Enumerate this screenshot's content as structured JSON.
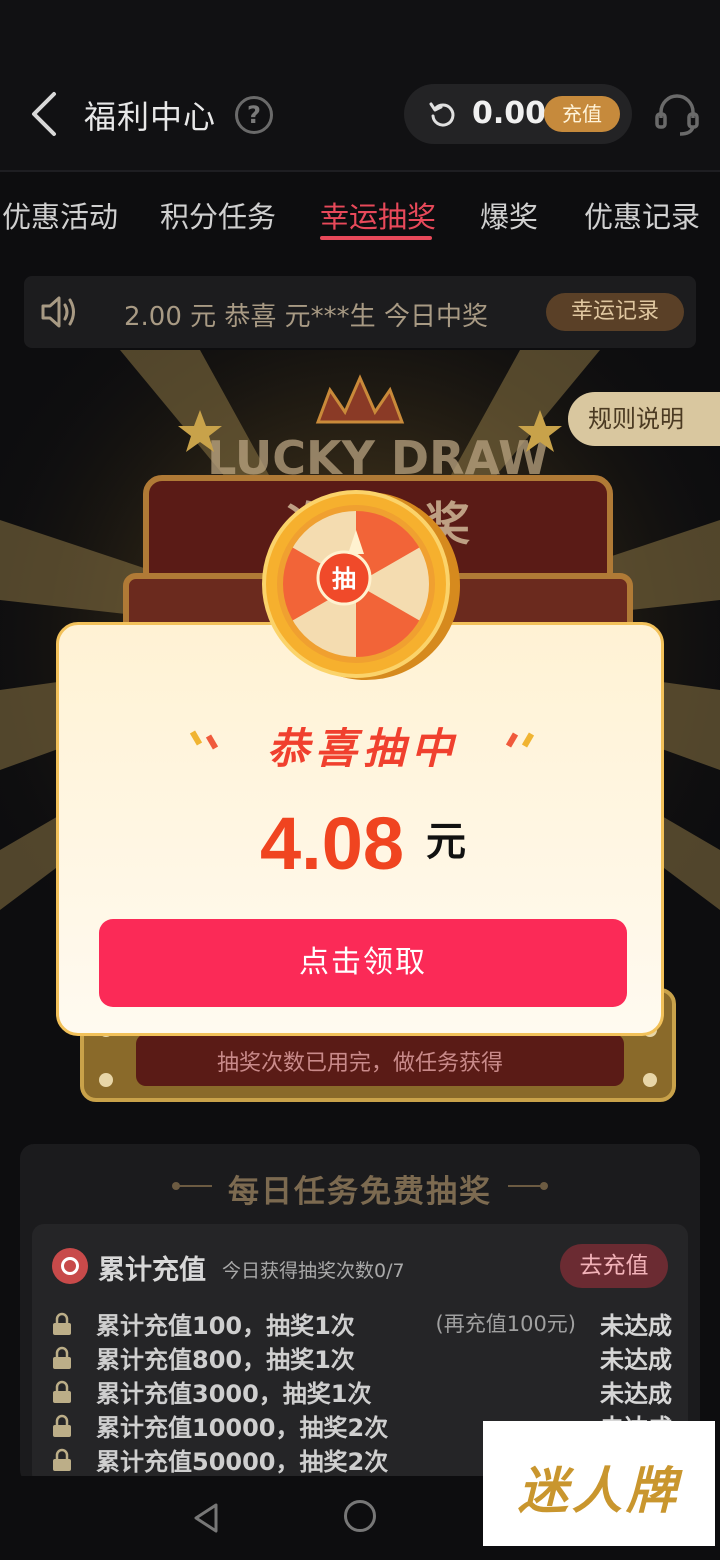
{
  "header": {
    "title": "福利中心",
    "balance": "0.00",
    "recharge_label": "充值"
  },
  "tabs": [
    {
      "label": "优惠活动"
    },
    {
      "label": "积分任务"
    },
    {
      "label": "幸运抽奖"
    },
    {
      "label": "爆奖"
    },
    {
      "label": "优惠记录"
    }
  ],
  "ticker": {
    "text": "2.00 元  恭喜 元***生  今日中奖",
    "record_label": "幸运记录"
  },
  "draw": {
    "banner_en": "LUCKY DRAW",
    "banner_cn": "次次中奖",
    "wheel_label": "抽",
    "rules_label": "规则说明",
    "exhausted_text": "抽奖次数已用完，做任务获得"
  },
  "modal": {
    "title": "恭喜抽中",
    "amount": "4.08",
    "unit": "元",
    "claim_label": "点击领取"
  },
  "tasks": {
    "title": "每日任务免费抽奖",
    "card": {
      "name": "累计充值",
      "subtitle": "今日获得抽奖次数0/7",
      "action_label": "去充值",
      "rows": [
        {
          "label": "累计充值100，抽奖1次",
          "hint": "(再充值100元)",
          "status": "未达成"
        },
        {
          "label": "累计充值800，抽奖1次",
          "hint": "",
          "status": "未达成"
        },
        {
          "label": "累计充值3000，抽奖1次",
          "hint": "",
          "status": "未达成"
        },
        {
          "label": "累计充值10000，抽奖2次",
          "hint": "",
          "status": "未达成"
        },
        {
          "label": "累计充值50000，抽奖2次",
          "hint": "",
          "status": ""
        }
      ]
    }
  },
  "watermark": "迷人牌",
  "colors": {
    "accent": "#e8495a",
    "claim_button": "#fb2a57",
    "amount": "#f04420",
    "gold": "#c68a3c"
  }
}
